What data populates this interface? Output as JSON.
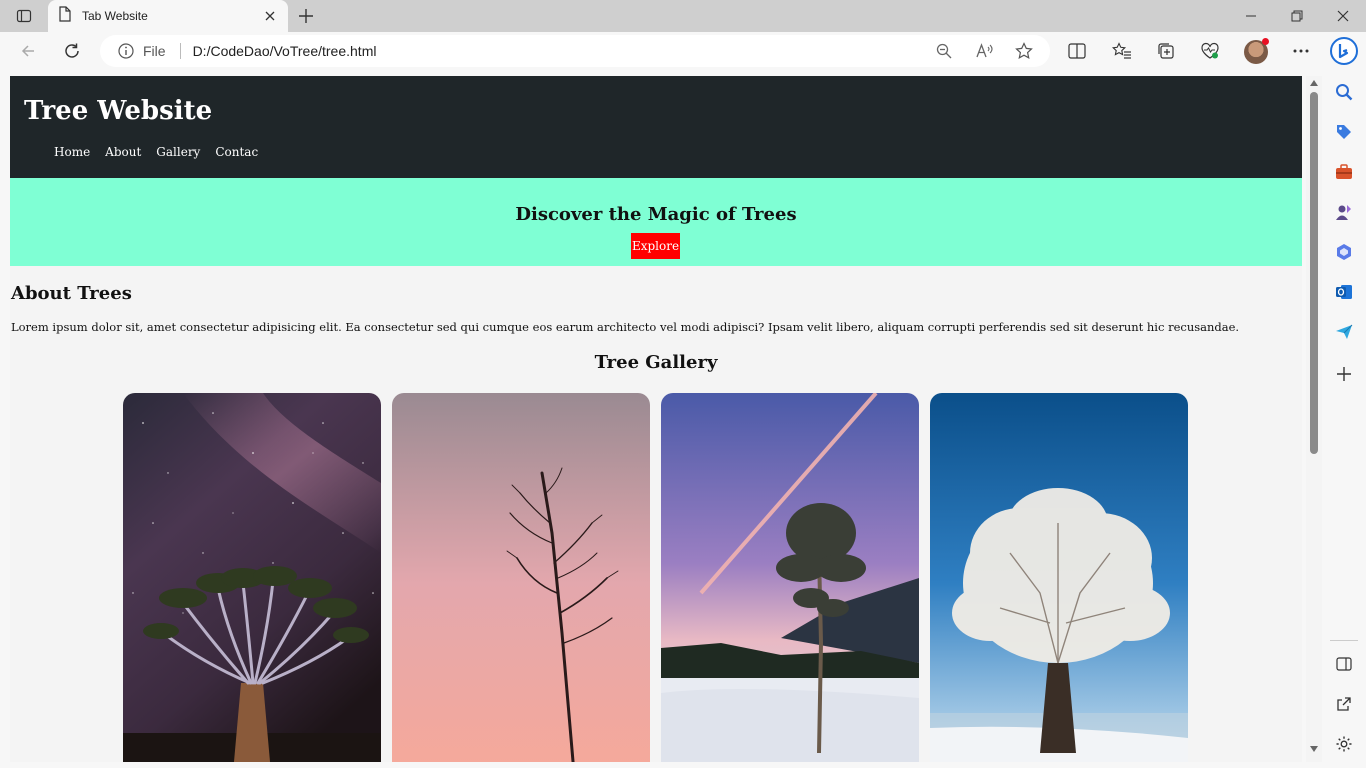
{
  "browser": {
    "tab_title": "Tab Website",
    "address": {
      "scheme_label": "File",
      "url": "D:/CodeDao/VoTree/tree.html"
    }
  },
  "page": {
    "site_title": "Tree Website",
    "nav": [
      "Home",
      "About",
      "Gallery",
      "Contac"
    ],
    "hero": {
      "title": "Discover the Magic of Trees",
      "button": "Explore"
    },
    "about": {
      "heading": "About Trees",
      "text": "Lorem ipsum dolor sit, amet consectetur adipisicing elit. Ea consectetur sed qui cumque eos earum architecto vel modi adipisci? Ipsam velit libero, aliquam corrupti perferendis sed sit deserunt hic recusandae."
    },
    "gallery": {
      "heading": "Tree Gallery"
    }
  },
  "colors": {
    "header_bg": "#1f2629",
    "hero_bg": "#7fffd4",
    "button_bg": "#ff0000"
  }
}
